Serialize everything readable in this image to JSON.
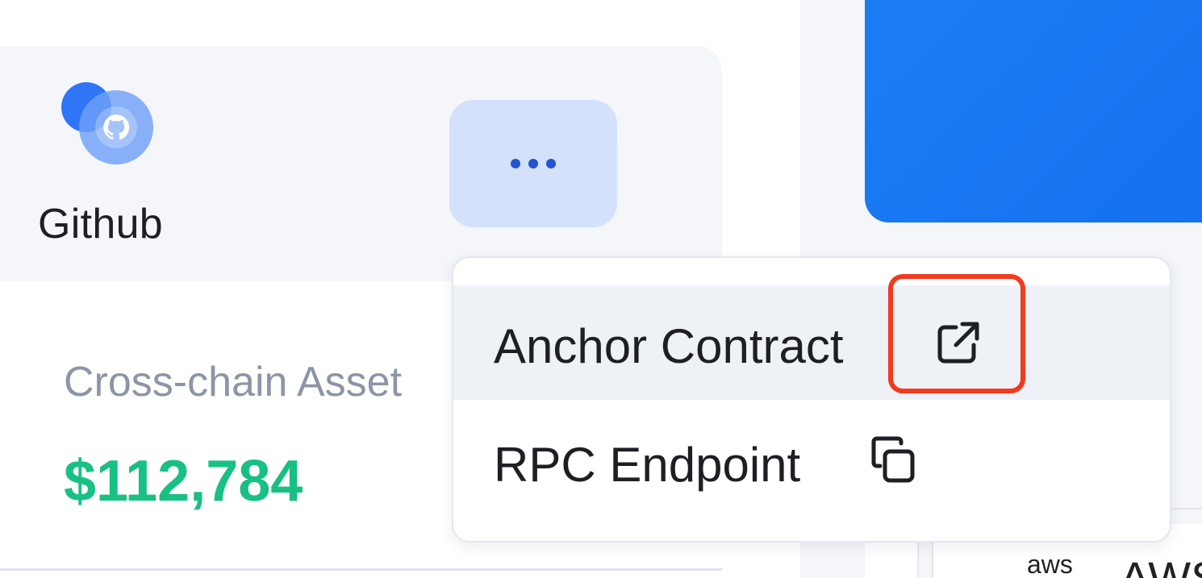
{
  "card": {
    "title": "Github",
    "more_icon": "more-horizontal-icon",
    "logo_icon": "github-icon",
    "stat_label": "Cross-chain Asset",
    "stat_value": "$112,784"
  },
  "menu": {
    "items": [
      {
        "label": "Anchor Contract",
        "icon": "external-link-icon"
      },
      {
        "label": "RPC Endpoint",
        "icon": "copy-icon"
      }
    ]
  },
  "right_panel": {
    "logo_text": "aws",
    "name_text": "AWS"
  },
  "colors": {
    "accent": "#2f76f6",
    "value_green": "#18c084",
    "highlight": "#f23a1e"
  }
}
